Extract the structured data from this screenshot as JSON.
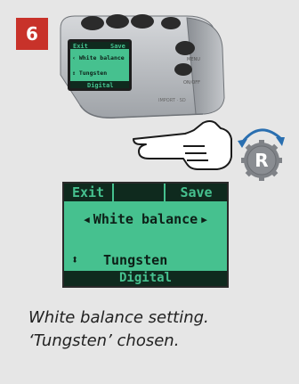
{
  "step": {
    "number": "6"
  },
  "camera_lcd": {
    "exit_label": "Exit",
    "save_label": "Save",
    "menu_title": "White balance",
    "value": "Tungsten",
    "mode": "Digital"
  },
  "lcd": {
    "exit_label": "Exit",
    "save_label": "Save",
    "menu_title": "White balance",
    "value": "Tungsten",
    "mode": "Digital"
  },
  "r_button": {
    "label": "R"
  },
  "caption": {
    "line1": "White balance setting.",
    "line2": "‘Tungsten’ chosen."
  },
  "colors": {
    "badge": "#c8322a",
    "lcd_green": "#46c18f",
    "lcd_dark": "#0f2a1e",
    "camera_body": "#b9bcc0"
  },
  "icons": [
    "hand-pointing-icon",
    "rotate-arrow-icon",
    "r-button-icon"
  ]
}
